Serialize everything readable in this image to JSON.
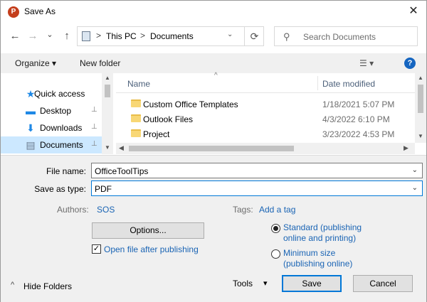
{
  "window": {
    "title": "Save As",
    "app_icon": "powerpoint-icon",
    "close_glyph": "✕"
  },
  "nav": {
    "back_glyph": "←",
    "forward_glyph": "→",
    "recent_glyph": "⌄",
    "up_glyph": "↑",
    "breadcrumb": [
      "This PC",
      "Documents"
    ],
    "sep_glyph": ">",
    "dropdown_glyph": "⌄",
    "refresh_glyph": "⟳"
  },
  "search": {
    "placeholder": "Search Documents",
    "icon": "search-icon"
  },
  "toolbar": {
    "organize": "Organize ▾",
    "new_folder": "New folder",
    "view_glyph": "☰ ▾",
    "help": "?"
  },
  "sidebar": {
    "items": [
      {
        "label": "Quick access",
        "icon": "star-icon",
        "glyph": "★"
      },
      {
        "label": "Desktop",
        "icon": "desktop-icon",
        "glyph": "▬"
      },
      {
        "label": "Downloads",
        "icon": "download-icon",
        "glyph": "⬇"
      },
      {
        "label": "Documents",
        "icon": "document-icon",
        "glyph": "▤"
      }
    ],
    "pin_glyph": "📌"
  },
  "files": {
    "columns": {
      "name": "Name",
      "date": "Date modified"
    },
    "sort_glyph": "^",
    "rows": [
      {
        "name": "Custom Office Templates",
        "date": "1/18/2021 5:07 PM"
      },
      {
        "name": "Outlook Files",
        "date": "4/3/2022 6:10 PM"
      },
      {
        "name": "Project",
        "date": "3/23/2022 4:53 PM"
      }
    ]
  },
  "form": {
    "file_name_label": "File name:",
    "file_name_value": "OfficeToolTips",
    "save_type_label": "Save as type:",
    "save_type_value": "PDF",
    "authors_label": "Authors:",
    "authors_value": "SOS",
    "tags_label": "Tags:",
    "tags_value": "Add a tag",
    "options_button": "Options...",
    "open_after_label": "Open file after publishing",
    "radio_standard_1": "Standard (publishing",
    "radio_standard_2": "online and printing)",
    "radio_min_1": "Minimum size",
    "radio_min_2": "(publishing online)",
    "checkmark": "✓",
    "dropdown_glyph": "⌄"
  },
  "footer": {
    "hide_folders": "Hide Folders",
    "hide_glyph": "^",
    "tools": "Tools",
    "tools_glyph": "▾",
    "save": "Save",
    "cancel": "Cancel"
  }
}
